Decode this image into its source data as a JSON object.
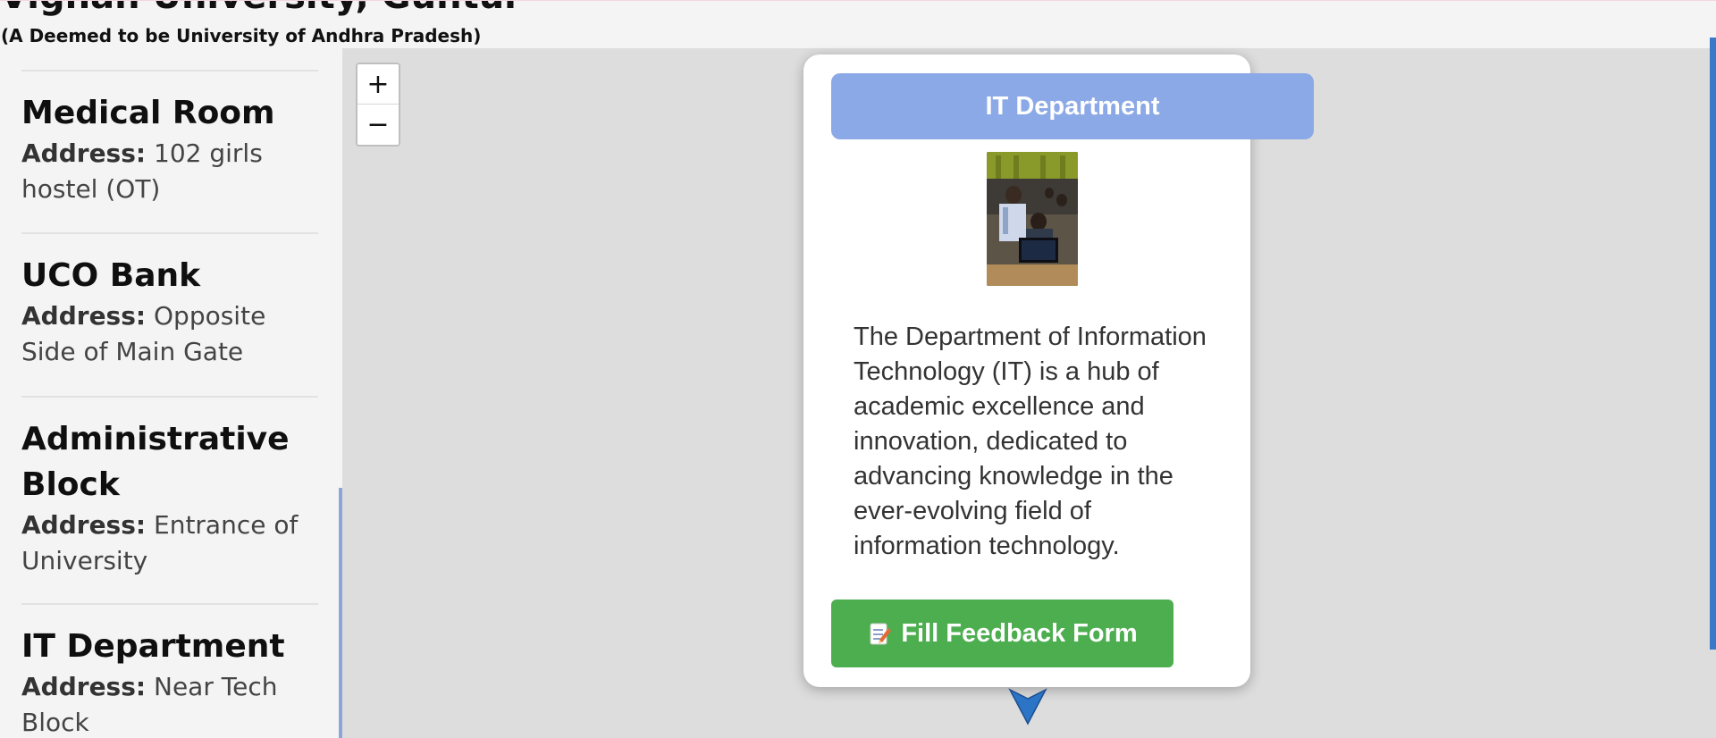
{
  "header": {
    "title": "Vignan University, Guntur",
    "subtitle": "(A Deemed to be University of Andhra Pradesh)"
  },
  "sidebar": {
    "address_label": "Address:",
    "items": [
      {
        "name": "Medical Room",
        "address": "102 girls hostel (OT)"
      },
      {
        "name": "UCO Bank",
        "address": "Opposite Side of Main Gate"
      },
      {
        "name": "Administrative Block",
        "address": "Entrance of University"
      },
      {
        "name": "IT Department",
        "address": "Near Tech Block"
      }
    ]
  },
  "map": {
    "zoom_in_label": "+",
    "zoom_out_label": "−"
  },
  "popup": {
    "title": "IT Department",
    "description": "The Department of Information Technology (IT) is a hub of academic excellence and innovation, dedicated to advancing knowledge in the ever-evolving field of information technology.",
    "button_label": "Fill Feedback Form",
    "button_icon": "memo-icon"
  },
  "colors": {
    "popup_title_bg": "#8ba9e6",
    "button_bg": "#4cae4f",
    "map_bg": "#dddddd",
    "marker": "#2b74c6"
  }
}
